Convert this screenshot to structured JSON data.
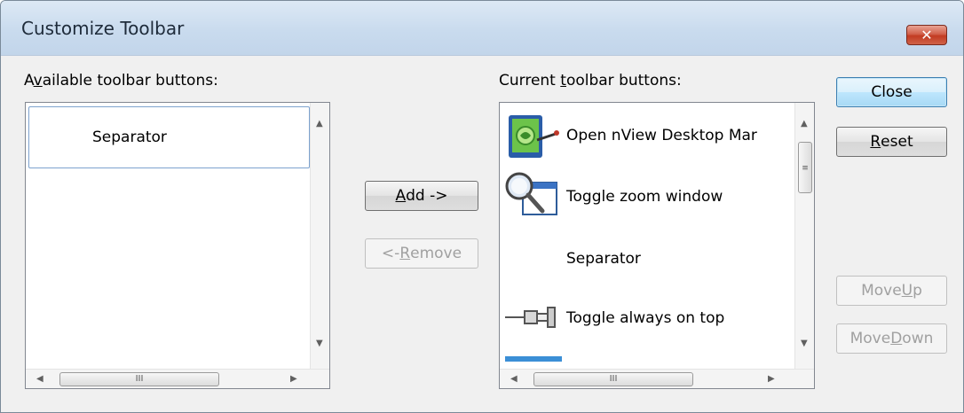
{
  "window": {
    "title": "Customize Toolbar",
    "close_glyph": "✕"
  },
  "available": {
    "label_pre": "A",
    "label_accel": "v",
    "label_post": "ailable toolbar buttons:",
    "items": [
      {
        "label": "Separator",
        "icon": "none",
        "selected": true
      }
    ]
  },
  "current": {
    "label_pre": "Current ",
    "label_accel": "t",
    "label_post": "oolbar buttons:",
    "items": [
      {
        "label": "Open nView Desktop Mar",
        "icon": "nview-desktop-manager-icon"
      },
      {
        "label": "Toggle zoom window",
        "icon": "zoom-window-icon"
      },
      {
        "label": "Separator",
        "icon": "none"
      },
      {
        "label": "Toggle always on top",
        "icon": "pushpin-icon"
      }
    ]
  },
  "buttons": {
    "add_accel": "A",
    "add_rest": "dd ->",
    "remove_pre": "<- ",
    "remove_accel": "R",
    "remove_rest": "emove",
    "close": "Close",
    "reset_accel": "R",
    "reset_rest": "eset",
    "moveup_pre": "Move ",
    "moveup_accel": "U",
    "moveup_rest": "p",
    "movedown_pre": "Move ",
    "movedown_accel": "D",
    "movedown_rest": "own"
  },
  "scrollbar": {
    "grip": "III",
    "vgrip": "≡",
    "up": "▲",
    "down": "▼",
    "left": "◀",
    "right": "▶"
  },
  "colors": {
    "close_button_red": "#c23b22",
    "default_button_blue": "#3c7fb1",
    "selection_border": "#7da2ce"
  }
}
